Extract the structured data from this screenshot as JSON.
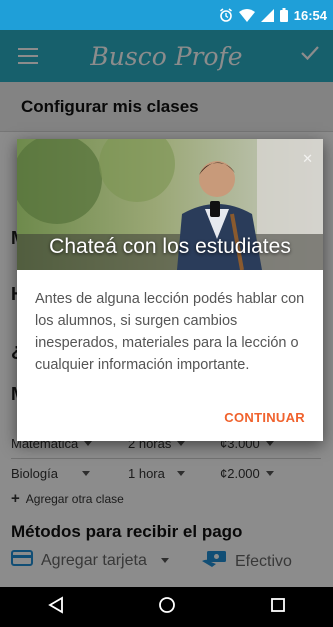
{
  "status_bar": {
    "time": "16:54",
    "icons": [
      "alarm-icon",
      "wifi-icon",
      "signal-icon",
      "battery-icon"
    ]
  },
  "app_bar": {
    "title": "Busco Profe",
    "icons": [
      "menu-icon",
      "check-icon"
    ]
  },
  "header": {
    "title": "Configurar mis clases"
  },
  "background_fragments": {
    "items": [
      "M",
      "H",
      "¿",
      "M"
    ]
  },
  "classes": [
    {
      "subject": "Matemática",
      "duration": "2 horas",
      "price": "¢3.000"
    },
    {
      "subject": "Biología",
      "duration": "1 hora",
      "price": "¢2.000"
    }
  ],
  "add_class_label": "Agregar otra clase",
  "payment": {
    "title": "Métodos para recibir el pago",
    "card_label": "Agregar tarjeta",
    "cash_label": "Efectivo"
  },
  "dialog": {
    "title": "Chateá con los estudiates",
    "body": "Antes de alguna lección podés hablar con los alumnos, si surgen cambios inesperados, materiales para la lección o cualquier información importante.",
    "action_label": "CONTINUAR"
  },
  "colors": {
    "primary": "#2ab0c5",
    "status": "#1f9fd8",
    "accent": "#f0622d",
    "card_icon": "#1f8fd6"
  }
}
